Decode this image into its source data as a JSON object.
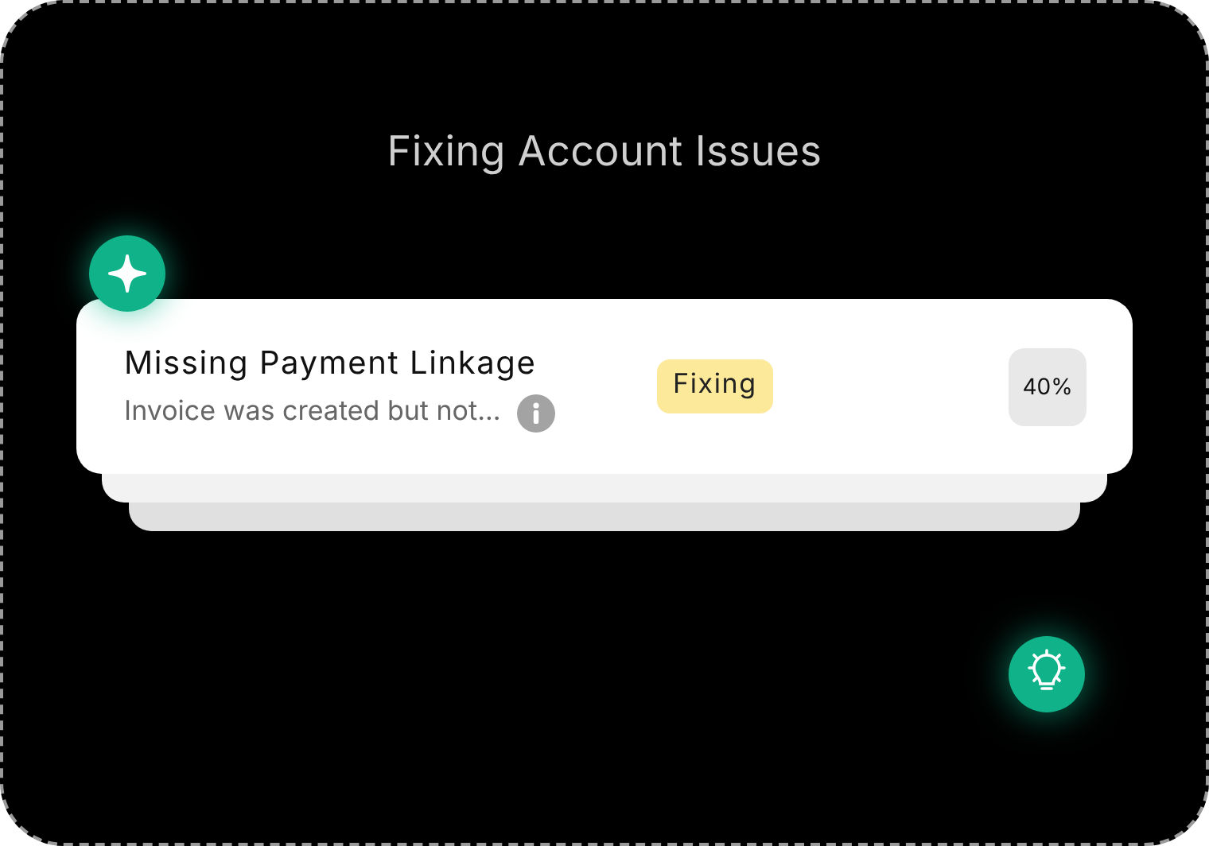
{
  "title": "Fixing Account Issues",
  "issue": {
    "name": "Missing Payment Linkage",
    "description": "Invoice was created but not...",
    "status": "Fixing",
    "progress": "40%"
  }
}
